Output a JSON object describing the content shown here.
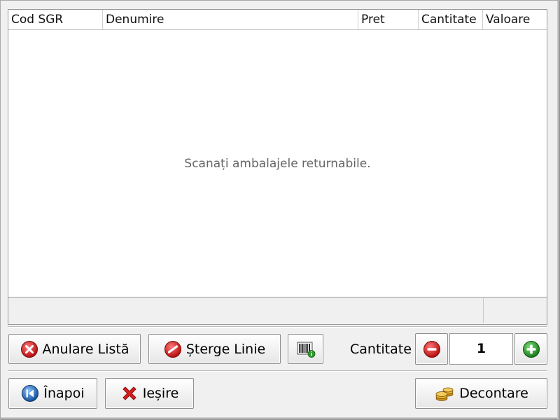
{
  "table": {
    "columns": [
      {
        "label": "Cod SGR"
      },
      {
        "label": "Denumire"
      },
      {
        "label": "Pret"
      },
      {
        "label": "Cantitate"
      },
      {
        "label": "Valoare"
      }
    ],
    "empty_message": "Scanați ambalajele returnabile."
  },
  "toolbar": {
    "cancel_list_label": "Anulare Listă",
    "delete_line_label": "Șterge Linie",
    "barcode_info_icon": "barcode-info-icon",
    "quantity_label": "Cantitate",
    "quantity_value": "1"
  },
  "bottom": {
    "back_label": "Înapoi",
    "exit_label": "Ieșire",
    "settle_label": "Decontare"
  },
  "colors": {
    "danger_red": "#d71f1f",
    "add_green": "#2e9b2e",
    "nav_blue": "#1f5fae",
    "coin_gold": "#d9a227"
  }
}
